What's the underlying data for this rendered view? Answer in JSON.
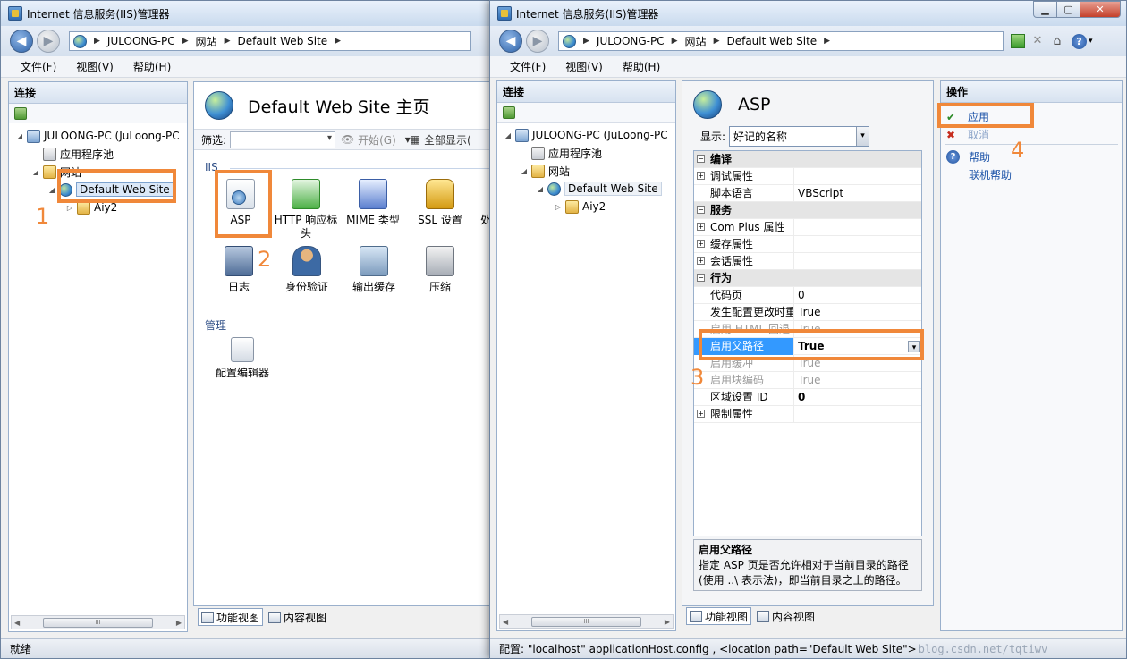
{
  "window1": {
    "title": "Internet 信息服务(IIS)管理器",
    "address": [
      "JULOONG-PC",
      "网站",
      "Default Web Site"
    ],
    "menu": [
      "文件(F)",
      "视图(V)",
      "帮助(H)"
    ],
    "connections": {
      "header": "连接",
      "tree": {
        "root": "JULOONG-PC (JuLoong-PC",
        "pool": "应用程序池",
        "sites": "网站",
        "site": "Default Web Site",
        "child": "Aiy2"
      }
    },
    "home": {
      "title": "Default Web Site 主页",
      "filter_label": "筛选:",
      "start_label": "开始(G)",
      "showall_label": "全部显示(",
      "group_iis": "IIS",
      "group_manage": "管理",
      "features_row1": [
        "ASP",
        "HTTP 响应标头",
        "MIME 类型",
        "SSL 设置",
        "处"
      ],
      "features_row2": [
        "日志",
        "身份验证",
        "输出缓存",
        "压缩"
      ],
      "config_editor": "配置编辑器"
    },
    "tabs": [
      "功能视图",
      "内容视图"
    ],
    "status": "就绪"
  },
  "window2": {
    "title": "Internet 信息服务(IIS)管理器",
    "address": [
      "JULOONG-PC",
      "网站",
      "Default Web Site"
    ],
    "menu": [
      "文件(F)",
      "视图(V)",
      "帮助(H)"
    ],
    "connections": {
      "header": "连接",
      "tree": {
        "root": "JULOONG-PC (JuLoong-PC",
        "pool": "应用程序池",
        "sites": "网站",
        "site": "Default Web Site",
        "child": "Aiy2"
      }
    },
    "asp": {
      "title": "ASP",
      "show_label": "显示:",
      "show_value": "好记的名称",
      "rows": [
        {
          "type": "cat",
          "label": "编译",
          "value": ""
        },
        {
          "type": "exp",
          "label": "调试属性",
          "value": ""
        },
        {
          "type": "prop",
          "label": "脚本语言",
          "value": "VBScript"
        },
        {
          "type": "cat",
          "label": "服务",
          "value": ""
        },
        {
          "type": "exp",
          "label": "Com Plus 属性",
          "value": ""
        },
        {
          "type": "exp",
          "label": "缓存属性",
          "value": ""
        },
        {
          "type": "exp",
          "label": "会话属性",
          "value": ""
        },
        {
          "type": "cat",
          "label": "行为",
          "value": ""
        },
        {
          "type": "prop",
          "label": "代码页",
          "value": "0"
        },
        {
          "type": "prop",
          "label": "发生配置更改时重",
          "value": "True"
        },
        {
          "type": "dim",
          "label": "启用 HTML 回退",
          "value": "True"
        },
        {
          "type": "sel",
          "label": "启用父路径",
          "value": "True"
        },
        {
          "type": "dim",
          "label": "启用缓冲",
          "value": "True"
        },
        {
          "type": "dim",
          "label": "启用块编码",
          "value": "True"
        },
        {
          "type": "bold",
          "label": "区域设置 ID",
          "value": "0"
        },
        {
          "type": "exp",
          "label": "限制属性",
          "value": ""
        }
      ],
      "desc_title": "启用父路径",
      "desc_text": "指定 ASP 页是否允许相对于当前目录的路径(使用 ..\\ 表示法)，即当前目录之上的路径。"
    },
    "actions": {
      "header": "操作",
      "apply": "应用",
      "cancel": "取消",
      "help": "帮助",
      "online_help": "联机帮助"
    },
    "tabs": [
      "功能视图",
      "内容视图"
    ],
    "status": "配置: \"localhost\"  applicationHost.config , <location path=\"Default Web Site\">",
    "watermark": "blog.csdn.net/tqtiwv"
  },
  "callouts": [
    "1",
    "2",
    "3",
    "4"
  ],
  "colors": {
    "highlight": "#f0883a",
    "selection": "#3399ff",
    "link": "#1c53a8"
  }
}
